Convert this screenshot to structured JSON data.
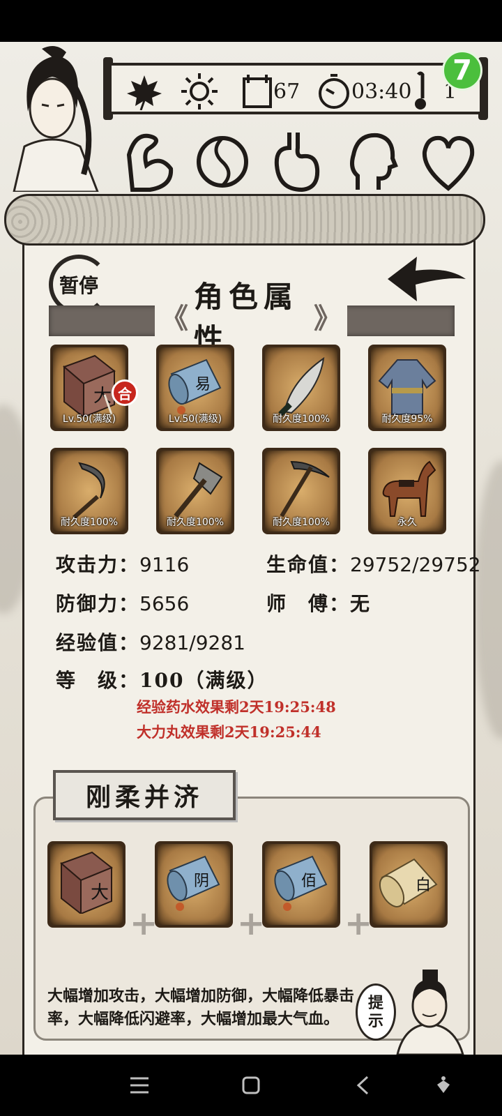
{
  "top_bar": {
    "season_icon": "maple-leaf-icon",
    "weather_icon": "sun-icon",
    "day_count": "67",
    "time": "03:40",
    "thermometer_value": "1",
    "badge_text": "7"
  },
  "attributes": [
    "muscle-icon",
    "yin-yang-icon",
    "stomach-icon",
    "head-icon",
    "heart-icon"
  ],
  "panel": {
    "pause_label": "暂停",
    "title": "角色属性",
    "title_left_chevron": "《",
    "title_right_chevron": "》"
  },
  "equipment": [
    {
      "icon": "book-icon",
      "label": "Lv.50(满级)",
      "glyph": "大",
      "badge": "合"
    },
    {
      "icon": "scroll-icon",
      "label": "Lv.50(满级)",
      "glyph": "易"
    },
    {
      "icon": "blade-icon",
      "label": "耐久度100%"
    },
    {
      "icon": "robe-icon",
      "label": "耐久度95%"
    },
    {
      "icon": "sickle-icon",
      "label": "耐久度100%"
    },
    {
      "icon": "axe-icon",
      "label": "耐久度100%"
    },
    {
      "icon": "pickaxe-icon",
      "label": "耐久度100%"
    },
    {
      "icon": "horse-icon",
      "label": "永久"
    }
  ],
  "stats": {
    "attack_label": "攻击力：",
    "attack_value": "9116",
    "hp_label": "生命值：",
    "hp_value": "29752/29752",
    "defense_label": "防御力：",
    "defense_value": "5656",
    "master_label": "师　傅：",
    "master_value": "无",
    "exp_label": "经验值：",
    "exp_value": "9281/9281",
    "level_label": "等　级：",
    "level_value": "100（满级）"
  },
  "buffs": [
    "经验药水效果剩2天19:25:48",
    "大力丸效果剩2天19:25:44"
  ],
  "combo": {
    "title": "刚柔并济",
    "items": [
      {
        "icon": "book-icon",
        "glyph": "大"
      },
      {
        "icon": "scroll-icon",
        "glyph": "阴"
      },
      {
        "icon": "scroll-icon",
        "glyph": "佰"
      },
      {
        "icon": "bamboo-scroll-icon",
        "glyph": "白"
      }
    ],
    "plus": "+",
    "description": "大幅增加攻击，大幅增加防御，大幅降低暴击率，大幅降低闪避率，大幅增加最大气血。",
    "hint_line1": "提",
    "hint_line2": "示"
  },
  "colors": {
    "buff_text": "#c0302a",
    "badge_green": "#4bbf3d",
    "badge_red": "#c7261d"
  }
}
